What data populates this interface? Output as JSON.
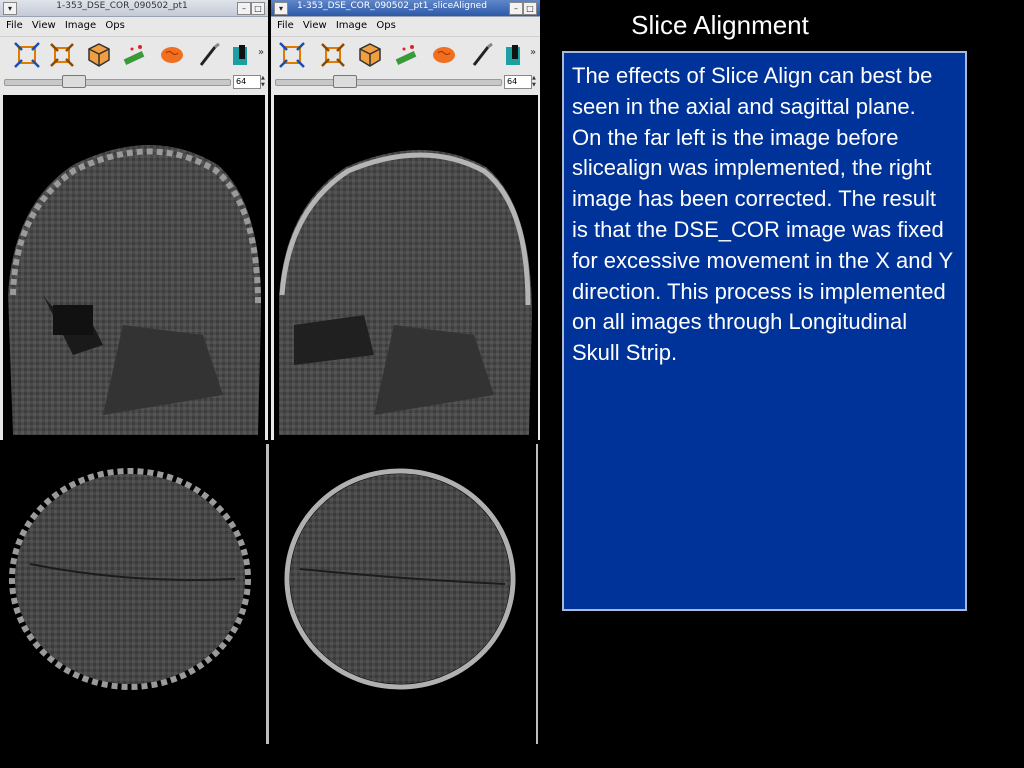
{
  "slide": {
    "title": "Slice Alignment",
    "paragraphs": [
      "The effects of Slice Align can best be seen in the axial and sagittal plane.",
      "On the far left is the image before slicealign was implemented, the right image has been corrected. The result is that the DSE_COR image was fixed for excessive movement in the X and Y direction. This process is implemented on all images through Longitudinal Skull Strip."
    ]
  },
  "windows": {
    "left": {
      "title": "1-353_DSE_COR_090502_pt1",
      "slider_value": "64"
    },
    "right": {
      "title": "1-353_DSE_COR_090502_pt1_sliceAligned",
      "slider_value": "64"
    },
    "menu": {
      "file": "File",
      "view": "View",
      "image": "Image",
      "ops": "Ops"
    }
  },
  "icons": [
    "crop-icon",
    "crop-alt-icon",
    "cube-icon",
    "skull-strip-icon",
    "brain-icon",
    "brush-icon",
    "segment-icon",
    "more-icon"
  ],
  "colors": {
    "text_box": "#003399",
    "background": "#000000",
    "active_titlebar": "#2c59a8"
  }
}
